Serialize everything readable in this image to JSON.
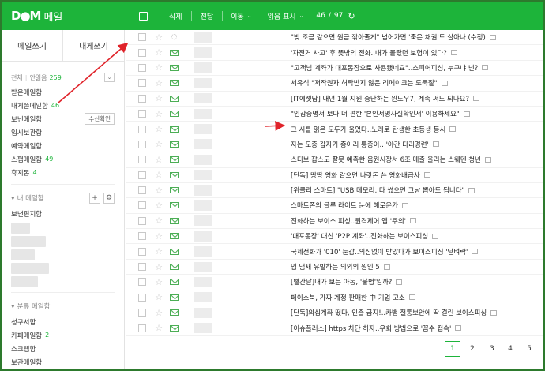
{
  "header": {
    "logo_mark": "D●M",
    "logo_text": "메일",
    "toolbar": {
      "delete": "삭제",
      "forward": "전달",
      "move": "이동",
      "read_display": "읽음 표시",
      "page_current": "46",
      "page_separator": "/",
      "page_total": "97"
    }
  },
  "sidebar": {
    "compose": "메일쓰기",
    "compose_self": "내게쓰기",
    "all_label": "전체",
    "unread_label": "안읽음",
    "unread_count": "259",
    "folders": [
      {
        "label": "받은메일함",
        "count": ""
      },
      {
        "label": "내게쓴메일함",
        "count": "46"
      },
      {
        "label": "보낸메일함",
        "count": "",
        "button": "수신확인"
      },
      {
        "label": "임시보관함",
        "count": ""
      },
      {
        "label": "예약메일함",
        "count": ""
      },
      {
        "label": "스팸메일함",
        "count": "49"
      },
      {
        "label": "휴지통",
        "count": "4"
      }
    ],
    "my_box_label": "내 메일함",
    "my_box_items": [
      {
        "label": "보낸편지함"
      }
    ],
    "category_label": "분류 메일함",
    "category_items": [
      {
        "label": "청구서함",
        "count": ""
      },
      {
        "label": "카페메일함",
        "count": "2"
      },
      {
        "label": "스크랩함",
        "count": ""
      },
      {
        "label": "보관메일함",
        "count": ""
      }
    ]
  },
  "mails": [
    {
      "subject": "\"빚 조금 갚으면 원금 깎아줄게\" 넘어가면 '죽은 채권'도 살아나 (수정)",
      "read": true
    },
    {
      "subject": "'자전거 사고' 후 뜻밖의 전화..내가 몰랐던 보험이 있다?",
      "read": false
    },
    {
      "subject": "\"고객님 계좌가 대포통장으로 사용됐네요\"..스피어피싱, 누구냐 넌?",
      "read": false
    },
    {
      "subject": "서유석 \"저작권자 허락받지 않은 리메이크는 도둑질\"",
      "read": false
    },
    {
      "subject": "[IT에셋담] 내년 1월 지원 중단하는 윈도우7, 계속 써도 되나요?",
      "read": false
    },
    {
      "subject": "\"인감증명서 보다 더 편한 '본인서명사실확인서' 이용하세요\"",
      "read": false
    },
    {
      "subject": "그 시를 읽은 모두가 울었다..노래로 탄생한 초등생 동시",
      "read": false
    },
    {
      "subject": "자는 도중 갑자기 종아리 통증이.. '야간 다리경련'",
      "read": false
    },
    {
      "subject": "스티브 잡스도 잘못 예측한 음원시장서 6조 매출 올리는 스웨덴 청년",
      "read": false
    },
    {
      "subject": "[단독] 땅땅 영화 같으면 나랏돈 쓴 영화배급사",
      "read": false
    },
    {
      "subject": "[위클리 스마트] \"USB 메모리, 다 썼으면 그냥 뽑아도 됩니다\"",
      "read": false
    },
    {
      "subject": "스마트폰의 블루 라이트 눈에 해로운가",
      "read": false
    },
    {
      "subject": "진화하는 보이스 피싱..원격제어 앱 '주의'",
      "read": false
    },
    {
      "subject": "'대포통장' 대신 'P2P 계좌'..진화하는 보이스피싱",
      "read": false
    },
    {
      "subject": "국제전화가 '010' 둔갑..의심없이 받았다가 보이스피싱 '날벼락'",
      "read": false
    },
    {
      "subject": "입 냄새 유발하는 의외의 원인 5",
      "read": false
    },
    {
      "subject": "[빨간날]내가 보는 아동, '불법'일까?",
      "read": false
    },
    {
      "subject": "페이스북, 가짜 계정 판매한 中 기업 고소",
      "read": false
    },
    {
      "subject": "[단독]의심계좌 떴다, 인출 금지!..카뱅 철통보안에 딱 걸린 보이스피싱",
      "read": false
    },
    {
      "subject": "[이슈플러스] https 차단 하자..우회 방법으로 '꼼수 접속'",
      "read": false
    }
  ],
  "pagination": [
    "1",
    "2",
    "3",
    "4",
    "5"
  ],
  "colors": {
    "brand": "#1db43a",
    "annotation": "#e0232a"
  }
}
